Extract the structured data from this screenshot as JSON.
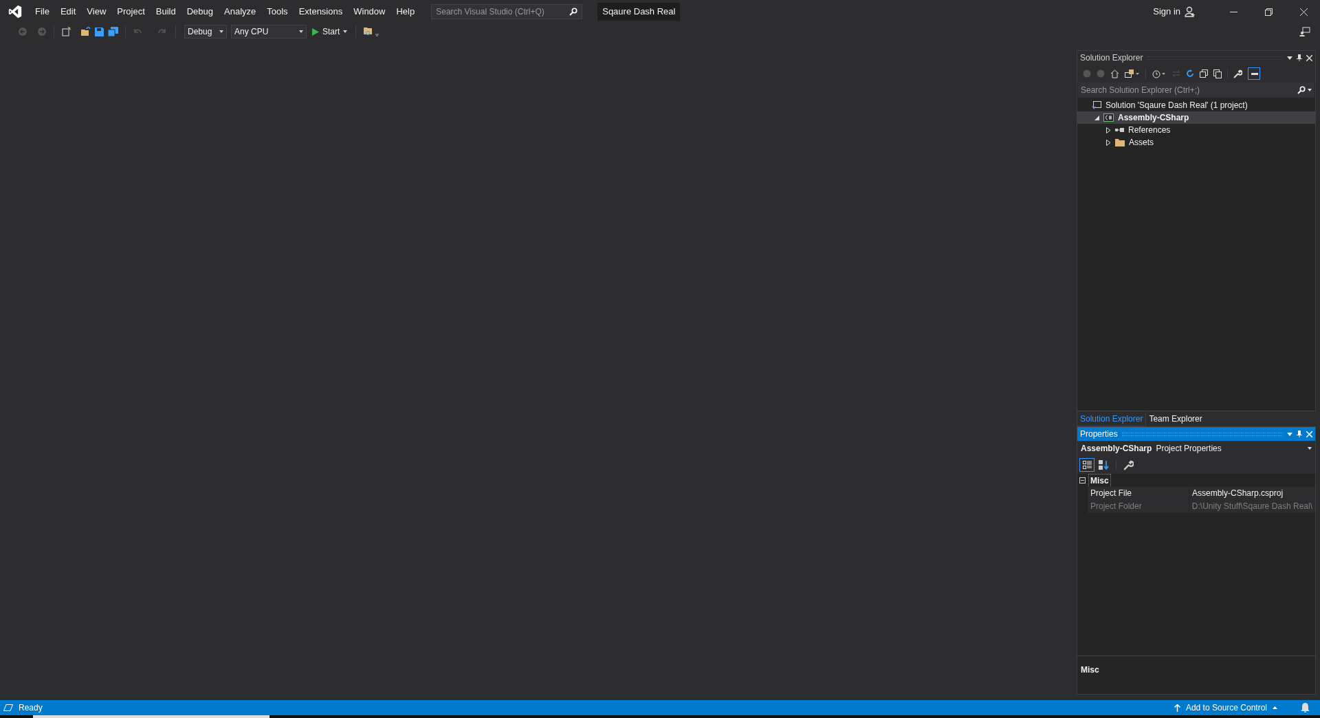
{
  "menu": [
    "File",
    "Edit",
    "View",
    "Project",
    "Build",
    "Debug",
    "Analyze",
    "Tools",
    "Extensions",
    "Window",
    "Help"
  ],
  "search": {
    "placeholder": "Search Visual Studio (Ctrl+Q)"
  },
  "solution_name": "Sqaure Dash Real",
  "sign_in": "Sign in",
  "toolbar": {
    "configuration": "Debug",
    "platform": "Any CPU",
    "start": "Start"
  },
  "solution_explorer": {
    "title": "Solution Explorer",
    "search": {
      "placeholder": "Search Solution Explorer (Ctrl+;)"
    },
    "tree": [
      {
        "label": "Solution 'Sqaure Dash Real' (1 project)",
        "kind": "solution",
        "selected": false,
        "children": [
          {
            "label": "Assembly-CSharp",
            "kind": "project",
            "selected": true,
            "expanded": true,
            "children": [
              {
                "label": "References",
                "kind": "references",
                "selected": false,
                "expanded": false
              },
              {
                "label": "Assets",
                "kind": "folder",
                "selected": false,
                "expanded": false
              }
            ]
          }
        ]
      }
    ]
  },
  "tabs": [
    {
      "label": "Solution Explorer",
      "selected": true
    },
    {
      "label": "Team Explorer",
      "selected": false
    }
  ],
  "properties": {
    "title": "Properties",
    "object_name": "Assembly-CSharp",
    "object_type": "Project Properties",
    "categories": [
      {
        "name": "Misc",
        "expanded": true,
        "rows": [
          {
            "name": "Project File",
            "value": "Assembly-CSharp.csproj",
            "disabled": false
          },
          {
            "name": "Project Folder",
            "value": "D:\\Unity Stuff\\Sqaure Dash Real\\",
            "disabled": true
          }
        ]
      }
    ],
    "description": "Misc"
  },
  "status_bar": {
    "text": "Ready",
    "source_control": "Add to Source Control"
  }
}
